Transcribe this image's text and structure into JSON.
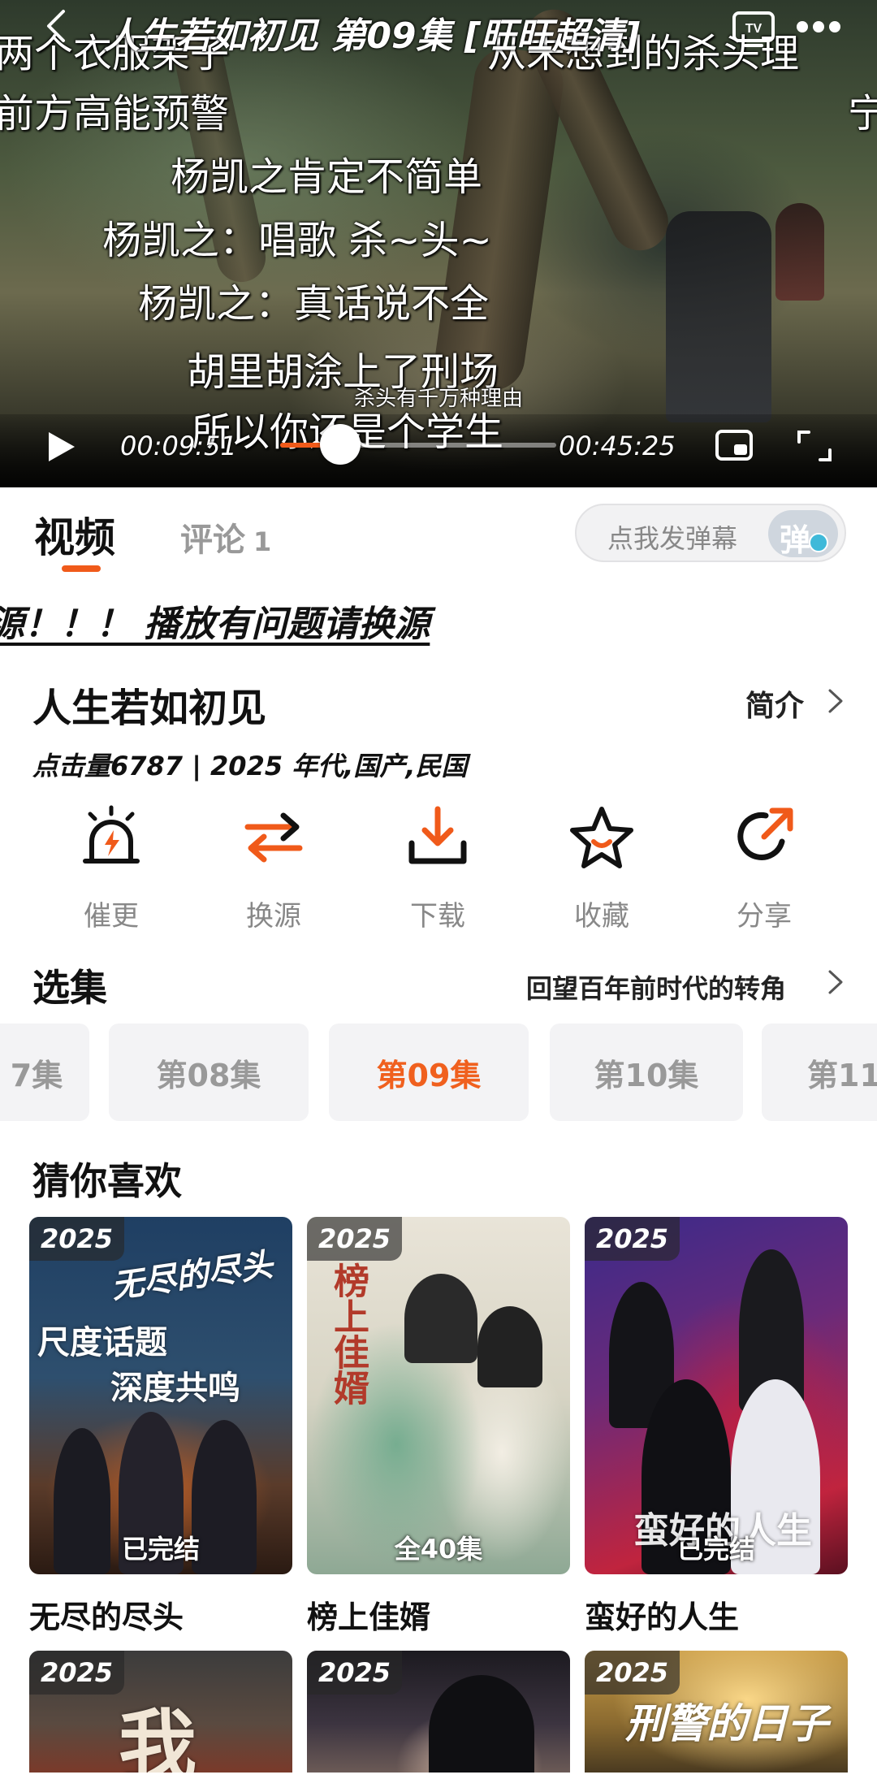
{
  "player": {
    "title": "人生若如初见 第09集 [旺旺超清]",
    "subtitle_text": "杀头有千万种理由",
    "current_time": "00:09:51",
    "total_time": "00:45:25",
    "progress": 0.217,
    "danmu": [
      "两个衣服架子",
      "从未想到的杀头理",
      "前方高能预警",
      "宁",
      "杨凯之肯定不简单",
      "杨凯之：唱歌 杀~头~",
      "杨凯之：真话说不全",
      "胡里胡涂上了刑场",
      "所以你还是个学生"
    ],
    "icons": {
      "back": "back-arrow-icon",
      "cast": "tv-cast-icon",
      "more": "more-dots-icon",
      "play": "play-icon",
      "pip": "picture-in-picture-icon",
      "fullscreen": "fullscreen-icon"
    }
  },
  "tabs": {
    "video": "视频",
    "comments": "评论",
    "comments_count": "1"
  },
  "danmaku_input": {
    "placeholder": "点我发弹幕",
    "toggle_label": "弹"
  },
  "notice": "源！！！ 播放有问题请换源",
  "info": {
    "title": "人生若如初见",
    "intro_link": "简介",
    "meta": "点击量6787 | 2025 年代,国产,民国"
  },
  "actions": [
    {
      "label": "催更",
      "icon": "alarm-icon"
    },
    {
      "label": "换源",
      "icon": "swap-arrows-icon"
    },
    {
      "label": "下载",
      "icon": "download-icon"
    },
    {
      "label": "收藏",
      "icon": "star-icon"
    },
    {
      "label": "分享",
      "icon": "share-icon"
    }
  ],
  "episodes": {
    "title": "选集",
    "subtitle": "回望百年前时代的转角",
    "items": [
      "7集",
      "第08集",
      "第09集",
      "第10集",
      "第11集"
    ],
    "active_index": 2
  },
  "recommend": {
    "title": "猜你喜欢",
    "items": [
      {
        "year": "2025",
        "status": "已完结",
        "title": "无尽的尽头",
        "art": [
          "无尽的尽头",
          "尺度话题",
          "深度共鸣"
        ]
      },
      {
        "year": "2025",
        "status": "全40集",
        "title": "榜上佳婿",
        "art": [
          "榜上佳婿"
        ]
      },
      {
        "year": "2025",
        "status": "已完结",
        "title": "蛮好的人生",
        "art": [
          "蛮好的人生"
        ]
      },
      {
        "year": "2025",
        "status": "",
        "title": "",
        "art": [
          "我"
        ]
      },
      {
        "year": "2025",
        "status": "",
        "title": "",
        "art": []
      },
      {
        "year": "2025",
        "status": "",
        "title": "",
        "art": [
          "刑警的日子"
        ]
      }
    ]
  },
  "colors": {
    "accent": "#f05a1a",
    "muted_text": "#999999",
    "episode_bg": "#f3f3f5"
  }
}
